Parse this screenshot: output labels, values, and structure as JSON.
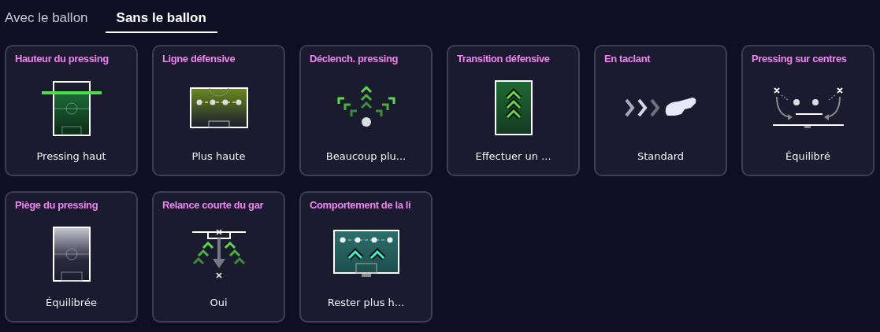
{
  "tabs": [
    {
      "label": "Avec le ballon",
      "selected": false
    },
    {
      "label": "Sans le ballon",
      "selected": true
    }
  ],
  "cards": [
    {
      "title": "Hauteur du pressing",
      "kind": "press-height",
      "value": "Pressing haut"
    },
    {
      "title": "Ligne défensive",
      "kind": "defensive-line",
      "value": "Plus haute"
    },
    {
      "title": "Déclench. pressing",
      "kind": "trigger",
      "value": "Beaucoup plu..."
    },
    {
      "title": "Transition défensive",
      "kind": "transition",
      "value": "Effectuer un ..."
    },
    {
      "title": "En taclant",
      "kind": "tackle",
      "value": "Standard"
    },
    {
      "title": "Pressing sur centres",
      "kind": "crosses",
      "value": "Équilibré"
    },
    {
      "title": "Piège du pressing",
      "kind": "trap",
      "value": "Équilibrée"
    },
    {
      "title": "Relance courte du gar",
      "kind": "keeper",
      "value": "Oui"
    },
    {
      "title": "Comportement de la li",
      "kind": "line-behaviour",
      "value": "Rester plus h..."
    }
  ]
}
